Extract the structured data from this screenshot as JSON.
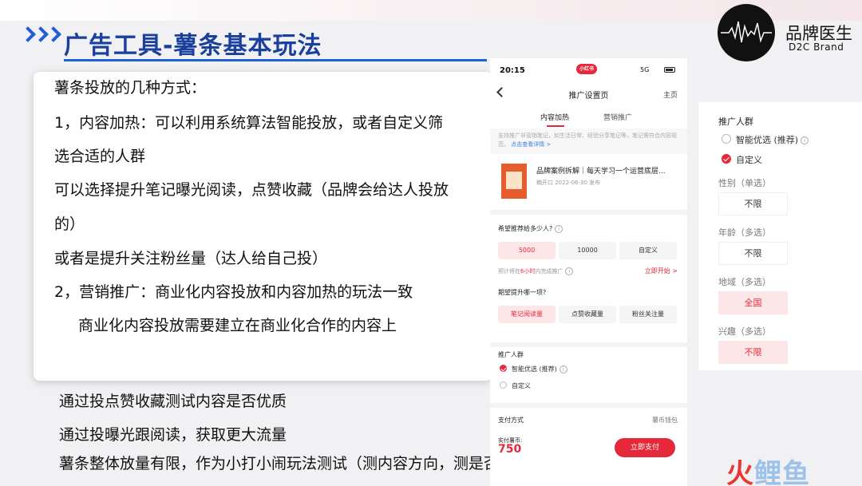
{
  "header": {
    "title": "广告工具-薯条基本玩法",
    "brand_name": "品牌医生",
    "brand_sub": "D2C Brand"
  },
  "card": {
    "lines": [
      "薯条投放的几种方式：",
      "1，内容加热：可以利用系统算法智能投放，或者自定义筛",
      "选合适的人群",
      "可以选择提升笔记曝光阅读，点赞收藏（品牌会给达人投放",
      "的）",
      "或者是提升关注粉丝量（达人给自己投）",
      "2，营销推广：商业化内容投放和内容加热的玩法一致",
      "商业化内容投放需要建立在商业化合作的内容上"
    ]
  },
  "bottom": {
    "lines": [
      "通过投点赞收藏测试内容是否优质",
      "通过投曝光跟阅读，获取更大流量",
      "薯条整体放量有限，作为小打小闹玩法测试（测内容方向，测是否限流）"
    ]
  },
  "phone": {
    "time": "20:15",
    "badge": "小红书",
    "signal": "5G",
    "nav_title": "推广设置页",
    "nav_home": "主页",
    "tabs": [
      "内容加热",
      "营销推广"
    ],
    "notice": "支持推广非营销笔记，如生活日常、经验分享笔记等，笔记需符合内容规范。",
    "notice_link": "点击查看详情 >",
    "note_title": "品牌案例拆解｜每天学习一个运营底层...",
    "note_meta": "楠开口    2022-06-30 发布",
    "q1": "希望推荐给多少人?",
    "q1_options": [
      "5000",
      "10000",
      "自定义"
    ],
    "est_prefix": "预计将在",
    "est_hours": "6小时",
    "est_suffix": "内完成推广",
    "start_now": "立即开始 >",
    "q2": "期望提升哪一项?",
    "q2_options": [
      "笔记阅读量",
      "点赞收藏量",
      "粉丝关注量"
    ],
    "audience_title": "推广人群",
    "audience_options": [
      "智能优选 (推荐)",
      "自定义"
    ],
    "pay_method": "支付方式",
    "wallet": "薯币钱包",
    "pay_coin_label": "实付薯币:",
    "pay_coin_value": "750",
    "pay_button": "立即支付"
  },
  "panel": {
    "title": "推广人群",
    "radio_options": [
      "智能优选 (推荐)",
      "自定义"
    ],
    "gender_label": "性别（单选）",
    "gender_value": "不限",
    "age_label": "年龄（多选）",
    "age_value": "不限",
    "region_label": "地域（多选）",
    "region_value": "全国",
    "interest_label": "兴趣（多选）",
    "interest_value": "不限"
  },
  "watermark": {
    "part1": "火",
    "part2": "鲤鱼"
  },
  "colors": {
    "title_blue": "#1b3f9c",
    "accent_red": "#e5283a"
  }
}
